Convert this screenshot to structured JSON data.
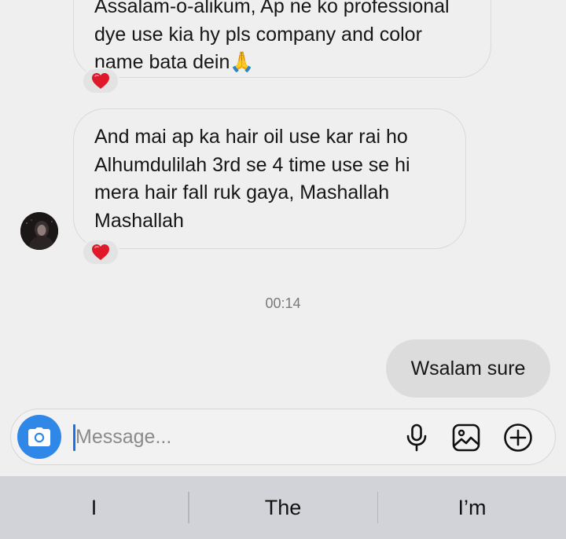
{
  "conversation": {
    "messages": [
      {
        "direction": "incoming",
        "lines": [
          "Assalam-o-alikum, Ap ne ko professional",
          "dye use kia hy pls company and color",
          "name bata dein"
        ],
        "emoji": "🙏",
        "reaction": "heart"
      },
      {
        "direction": "incoming",
        "lines": [
          "And mai ap ka hair oil use kar rai ho",
          "Alhumdulilah 3rd se 4 time use se hi",
          "mera hair fall ruk gaya, Mashallah",
          "Mashallah"
        ],
        "reaction": "heart"
      }
    ],
    "timestamp": "00:14",
    "outgoing": {
      "text": "Wsalam sure"
    }
  },
  "composer": {
    "placeholder": "Message...",
    "icons": [
      "camera-icon",
      "microphone-icon",
      "gallery-icon",
      "plus-circle-icon"
    ]
  },
  "keyboard": {
    "suggestions": [
      "I",
      "The",
      "I’m"
    ]
  },
  "colors": {
    "background": "#efefef",
    "outgoing_bubble": "#dcdcdc",
    "camera_button": "#2f87e8",
    "heart": "#e0192a",
    "keyboard_bar": "#d1d3d8"
  }
}
